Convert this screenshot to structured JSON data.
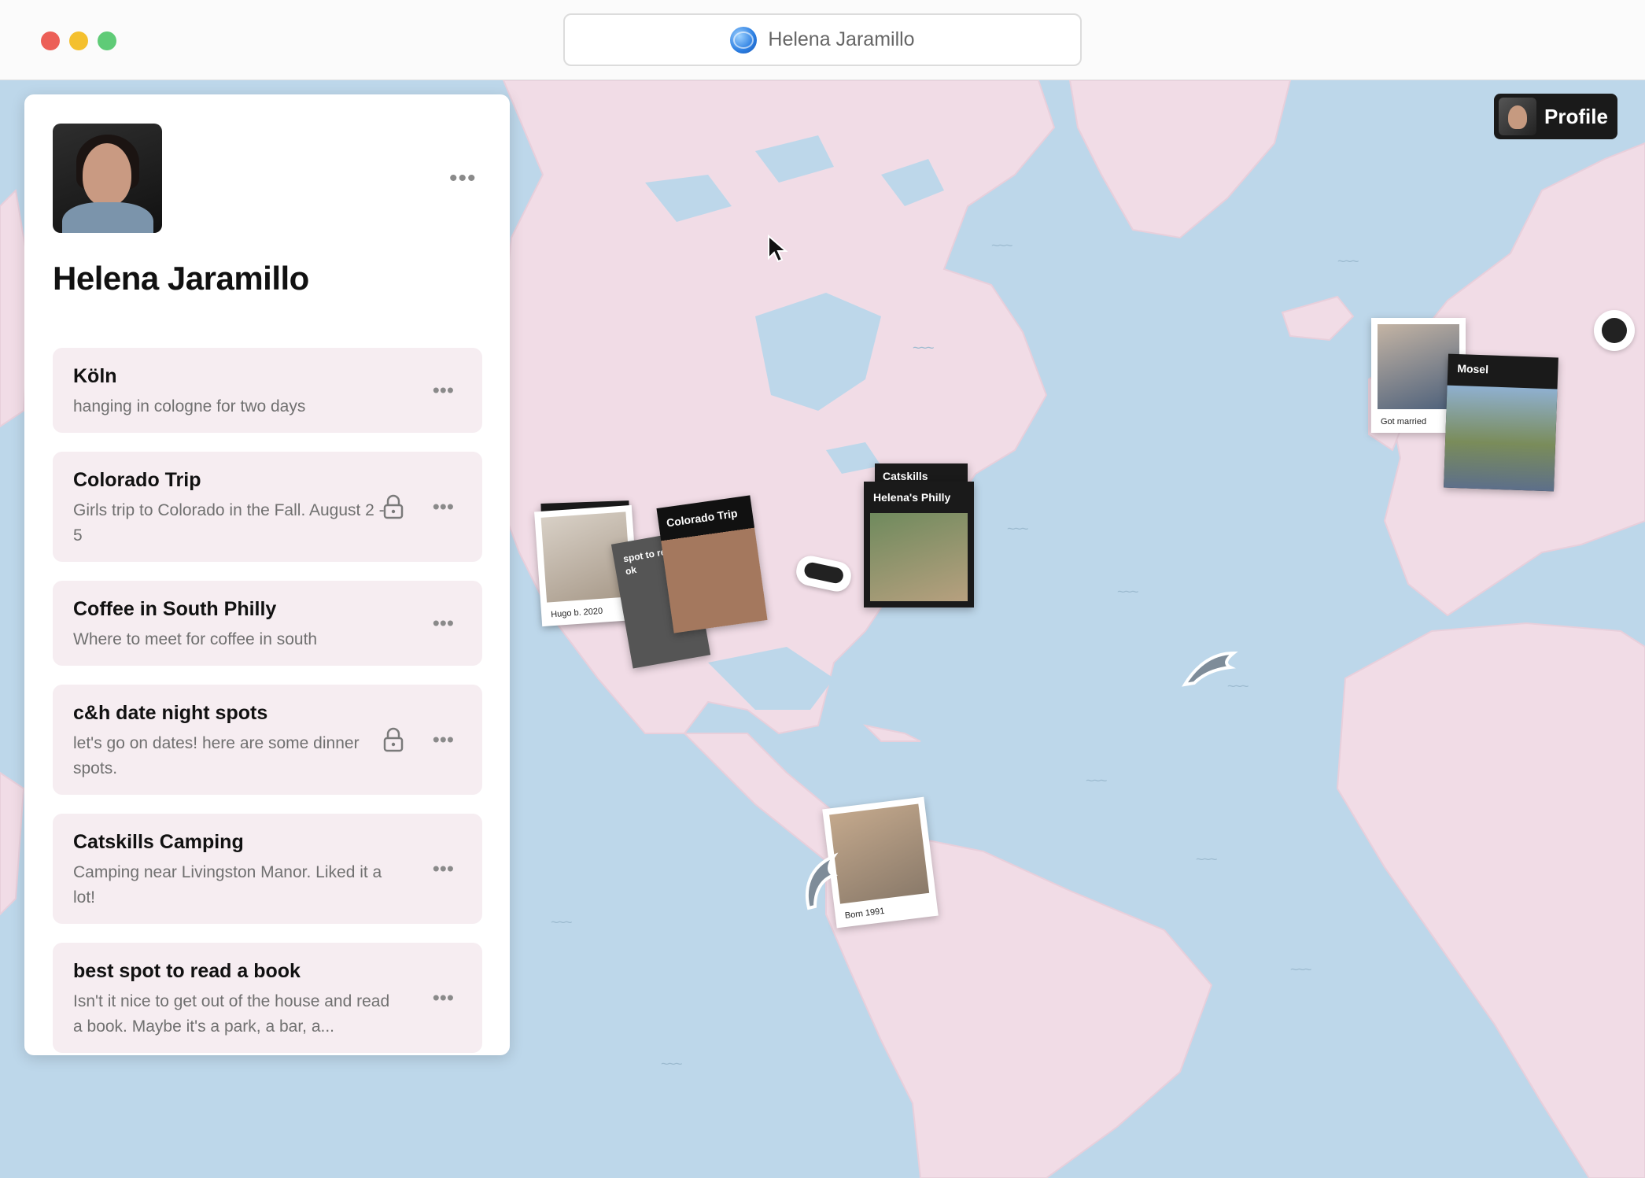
{
  "window": {
    "address_text": "Helena Jaramillo"
  },
  "profile_button": {
    "label": "Profile"
  },
  "panel": {
    "name": "Helena Jaramillo",
    "menu_glyph": "•••",
    "lists": [
      {
        "title": "Köln",
        "description": "hanging in cologne for two days",
        "locked": false
      },
      {
        "title": "Colorado Trip",
        "description": "Girls trip to Colorado in the Fall. August 2 - 5",
        "locked": true
      },
      {
        "title": "Coffee in South Philly",
        "description": "Where to meet for coffee in south",
        "locked": false
      },
      {
        "title": "c&h date night spots",
        "description": "let's go on dates! here are some dinner spots.",
        "locked": true
      },
      {
        "title": "Catskills Camping",
        "description": "Camping near Livingston Manor. Liked it a lot!",
        "locked": false
      },
      {
        "title": "best spot to read a book",
        "description": "Isn't it nice to get out of the house and read a book. Maybe it's a park, a bar, a...",
        "locked": false
      }
    ]
  },
  "map_items": {
    "hugo_caption": "Hugo b. 2020",
    "colorado_label": "Colorado Trip",
    "read_label": "spot to read",
    "read_label_suffix": "ok",
    "catskills_label": "Catskills",
    "philly_label": "Helena's Philly",
    "married_caption": "Got married",
    "mosel_label": "Mosel",
    "born_caption": "Born 1991"
  },
  "colors": {
    "land": "#f1dce6",
    "water": "#bdd7ea",
    "panel_card": "#f6edf1"
  }
}
